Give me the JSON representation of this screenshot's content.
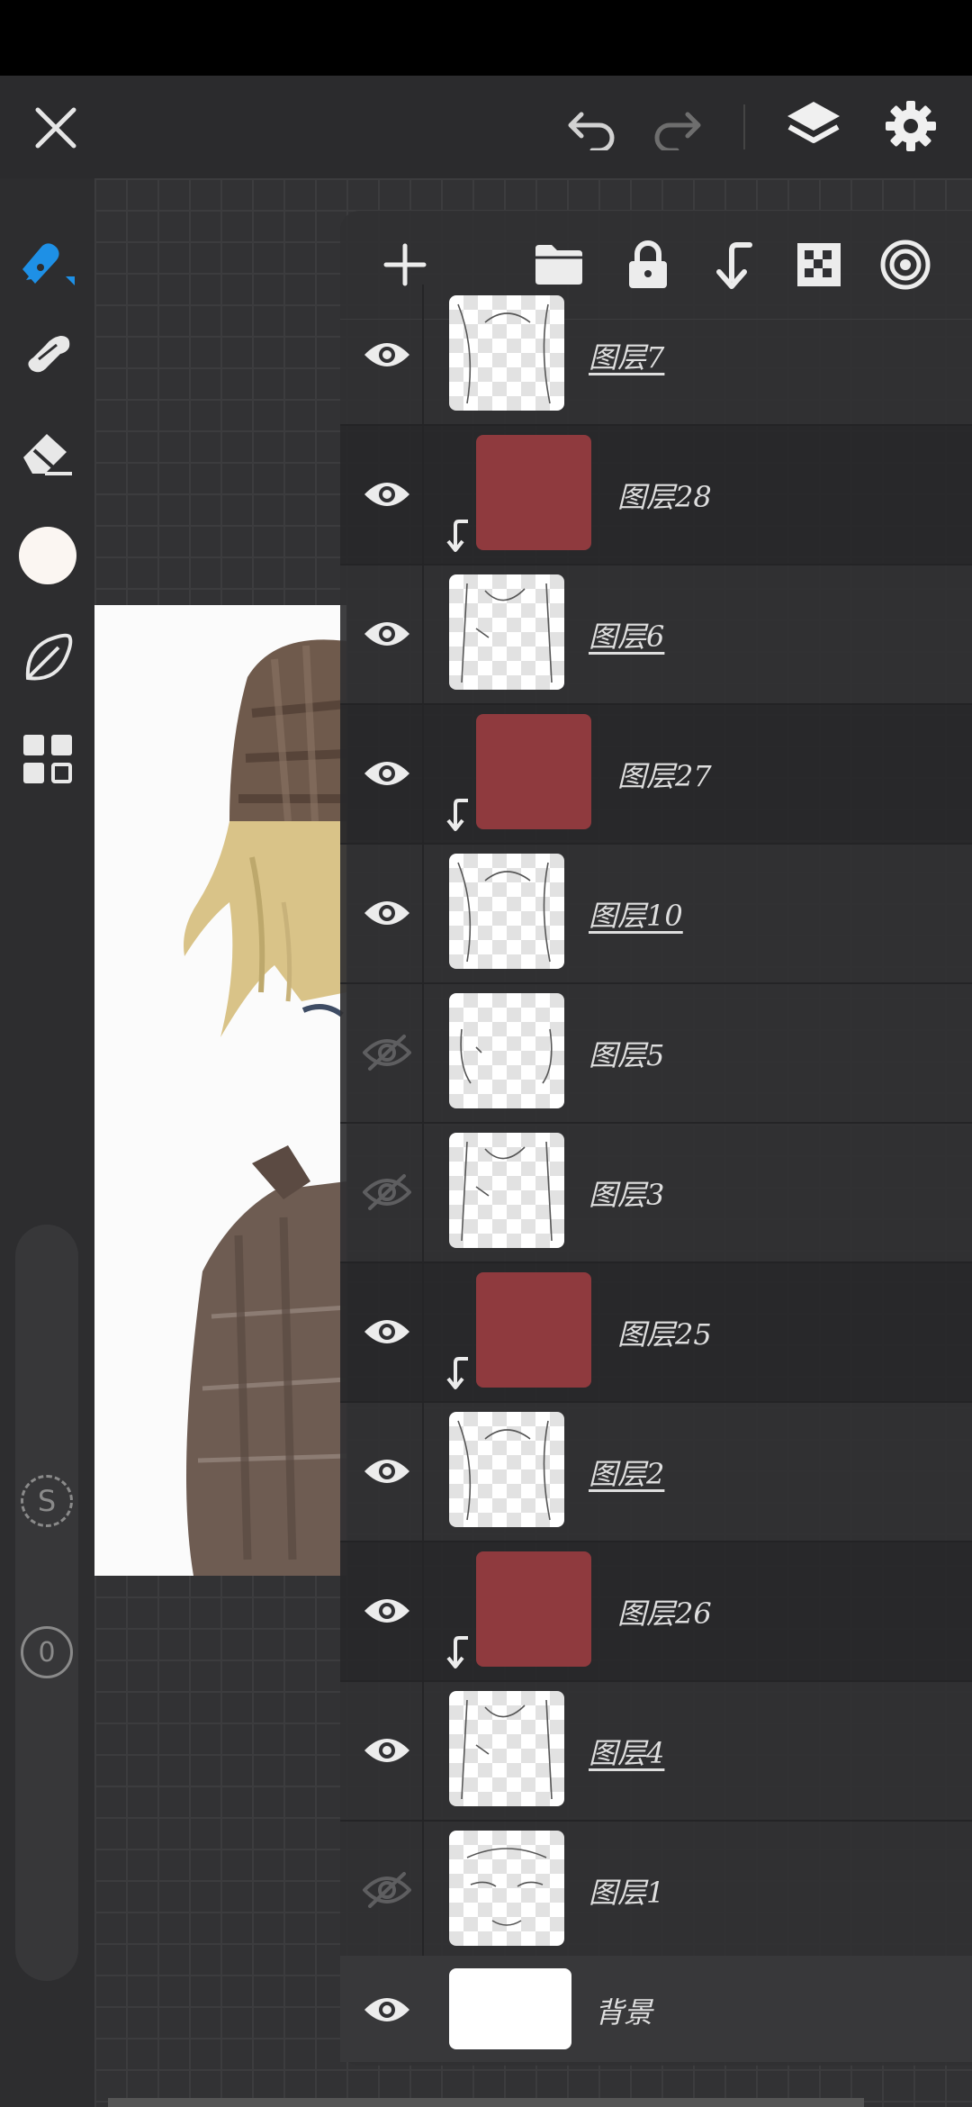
{
  "topbar": {
    "icons": [
      "close-icon",
      "undo-icon",
      "redo-icon",
      "layers-icon",
      "settings-icon"
    ]
  },
  "left_toolbar": {
    "tools": [
      "pen-tool-icon",
      "smudge-tool-icon",
      "eraser-tool-icon",
      "color-swatch",
      "brush-library-icon",
      "more-tools-icon"
    ],
    "current_color": "#fbf6f2",
    "accent": "#1e90e6",
    "stabilizer_label": "S",
    "opacity_label": "0"
  },
  "layers_panel": {
    "toolbar_icons": [
      "add-layer-icon",
      "folder-icon",
      "lock-icon",
      "clipping-mask-icon",
      "transparency-lock-icon",
      "blend-mode-icon"
    ],
    "layers": [
      {
        "name": "图层7",
        "visible": true,
        "type": "sketch",
        "underlined": true
      },
      {
        "name": "图层28",
        "visible": true,
        "type": "color",
        "clipped": true,
        "color": "#8f3a3e"
      },
      {
        "name": "图层6",
        "visible": true,
        "type": "sketch",
        "underlined": true
      },
      {
        "name": "图层27",
        "visible": true,
        "type": "color",
        "clipped": true,
        "color": "#8f3a3e"
      },
      {
        "name": "图层10",
        "visible": true,
        "type": "sketch",
        "underlined": true
      },
      {
        "name": "图层5",
        "visible": false,
        "type": "sketch"
      },
      {
        "name": "图层3",
        "visible": false,
        "type": "sketch"
      },
      {
        "name": "图层25",
        "visible": true,
        "type": "color",
        "clipped": true,
        "color": "#8f3a3e"
      },
      {
        "name": "图层2",
        "visible": true,
        "type": "sketch",
        "underlined": true
      },
      {
        "name": "图层26",
        "visible": true,
        "type": "color",
        "clipped": true,
        "color": "#8f3a3e"
      },
      {
        "name": "图层4",
        "visible": true,
        "type": "sketch",
        "underlined": true
      },
      {
        "name": "图层1",
        "visible": false,
        "type": "sketch"
      }
    ],
    "background_layer": {
      "name": "背景",
      "visible": true,
      "color": "#ffffff"
    }
  }
}
